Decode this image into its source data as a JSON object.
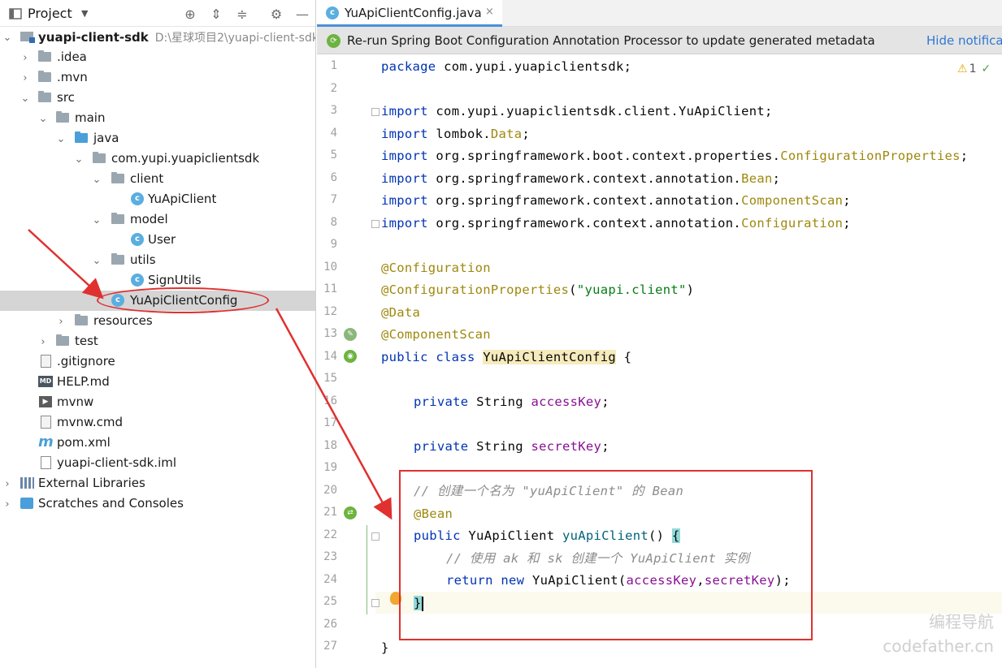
{
  "project_panel": {
    "title": "Project",
    "tree": [
      {
        "label": "yuapi-client-sdk",
        "path": "D:\\星球项目2\\yuapi-client-sdk",
        "icon": "module-folder-icon",
        "depth": 0,
        "expanded": true
      },
      {
        "label": ".idea",
        "icon": "folder-icon",
        "depth": 1,
        "expanded": false
      },
      {
        "label": ".mvn",
        "icon": "folder-icon",
        "depth": 1,
        "expanded": false
      },
      {
        "label": "src",
        "icon": "folder-icon",
        "depth": 1,
        "expanded": true
      },
      {
        "label": "main",
        "icon": "folder-icon",
        "depth": 2,
        "expanded": true
      },
      {
        "label": "java",
        "icon": "source-folder-icon",
        "depth": 3,
        "expanded": true
      },
      {
        "label": "com.yupi.yuapiclientsdk",
        "icon": "package-icon",
        "depth": 4,
        "expanded": true
      },
      {
        "label": "client",
        "icon": "package-icon",
        "depth": 5,
        "expanded": true
      },
      {
        "label": "YuApiClient",
        "icon": "java-class-icon",
        "depth": 6
      },
      {
        "label": "model",
        "icon": "package-icon",
        "depth": 5,
        "expanded": true
      },
      {
        "label": "User",
        "icon": "java-class-icon",
        "depth": 6
      },
      {
        "label": "utils",
        "icon": "package-icon",
        "depth": 5,
        "expanded": true
      },
      {
        "label": "SignUtils",
        "icon": "java-class-icon",
        "depth": 6
      },
      {
        "label": "YuApiClientConfig",
        "icon": "java-class-icon",
        "depth": 5,
        "selected": true
      },
      {
        "label": "resources",
        "icon": "resources-folder-icon",
        "depth": 3,
        "expanded": false
      },
      {
        "label": "test",
        "icon": "folder-icon",
        "depth": 2,
        "expanded": false
      },
      {
        "label": ".gitignore",
        "icon": "file-icon",
        "depth": 1
      },
      {
        "label": "HELP.md",
        "icon": "markdown-icon",
        "depth": 1
      },
      {
        "label": "mvnw",
        "icon": "terminal-icon",
        "depth": 1
      },
      {
        "label": "mvnw.cmd",
        "icon": "file-icon",
        "depth": 1
      },
      {
        "label": "pom.xml",
        "icon": "maven-icon",
        "depth": 1
      },
      {
        "label": "yuapi-client-sdk.iml",
        "icon": "iml-file-icon",
        "depth": 1
      },
      {
        "label": "External Libraries",
        "icon": "libraries-icon",
        "depth": 0,
        "expanded": false
      },
      {
        "label": "Scratches and Consoles",
        "icon": "scratches-icon",
        "depth": 0,
        "expanded": false
      }
    ]
  },
  "editor": {
    "tab_label": "YuApiClientConfig.java",
    "tab_close": "×",
    "banner_text": "Re-run Spring Boot Configuration Annotation Processor to update generated metadata",
    "banner_link": "Hide notifica",
    "warning_count": "1",
    "warning_glyph": "⚠",
    "check_glyph": "✓",
    "lines": [
      "1",
      "2",
      "3",
      "4",
      "5",
      "6",
      "7",
      "8",
      "9",
      "10",
      "11",
      "12",
      "13",
      "14",
      "15",
      "16",
      "17",
      "18",
      "19",
      "20",
      "21",
      "22",
      "23",
      "24",
      "25",
      "26",
      "27"
    ],
    "code": {
      "l1": {
        "kw": "package",
        "rest": " com.yupi.yuapiclientsdk;"
      },
      "l3": {
        "kw": "import",
        "rest": " com.yupi.yuapiclientsdk.client.YuApiClient;"
      },
      "l4": {
        "kw": "import",
        "rest": " lombok.",
        "ann": "Data",
        "end": ";"
      },
      "l5": {
        "kw": "import",
        "rest": " org.springframework.boot.context.properties.",
        "ann": "ConfigurationProperties",
        "end": ";"
      },
      "l6": {
        "kw": "import",
        "rest": " org.springframework.context.annotation.",
        "ann": "Bean",
        "end": ";"
      },
      "l7": {
        "kw": "import",
        "rest": " org.springframework.context.annotation.",
        "ann": "ComponentScan",
        "end": ";"
      },
      "l8": {
        "kw": "import",
        "rest": " org.springframework.context.annotation.",
        "ann": "Configuration",
        "end": ";"
      },
      "l10": "@Configuration",
      "l11": {
        "ann": "@ConfigurationProperties",
        "open": "(",
        "str": "\"yuapi.client\"",
        "close": ")"
      },
      "l12": "@Data",
      "l13": "@ComponentScan",
      "l14": {
        "kw": "public class",
        "cls": "YuApiClientConfig",
        "end": " {"
      },
      "l16": {
        "kw": "private",
        "type": " String ",
        "fld": "accessKey",
        "end": ";"
      },
      "l18": {
        "kw": "private",
        "type": " String ",
        "fld": "secretKey",
        "end": ";"
      },
      "l20": "// 创建一个名为 \"yuApiClient\" 的 Bean",
      "l21": "@Bean",
      "l22": {
        "kw": "public",
        "type": " YuApiClient ",
        "method": "yuApiClient",
        "end": "() ",
        "brace": "{"
      },
      "l23": "// 使用 ak 和 sk 创建一个 YuApiClient 实例",
      "l24": {
        "kw": "return new",
        "type": " YuApiClient(",
        "f1": "accessKey",
        "sep": ",",
        "f2": "secretKey",
        "end": ");"
      },
      "l25": "}",
      "l27": "}"
    }
  },
  "watermark": {
    "line1": "编程导航",
    "line2": "codefather.cn"
  },
  "colors": {
    "keyword": "#0033b3",
    "annotation": "#9e880d",
    "string": "#067d17",
    "field": "#871094",
    "comment": "#8c8c8c",
    "callout": "#e03030",
    "selection": "#d5d5d5"
  }
}
